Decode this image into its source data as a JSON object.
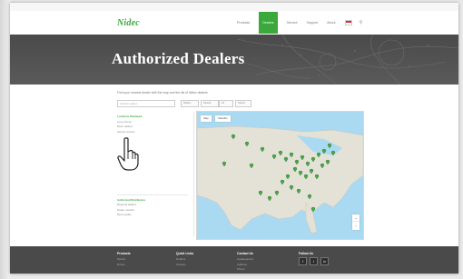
{
  "brand": {
    "logo_text": "Nidec",
    "accent": "#3aa83a"
  },
  "nav": {
    "items": [
      {
        "label": "Products",
        "active": false
      },
      {
        "label": "Dealers",
        "active": true
      },
      {
        "label": "Service",
        "active": false
      },
      {
        "label": "Support",
        "active": false
      },
      {
        "label": "About",
        "active": false
      }
    ]
  },
  "hero": {
    "title": "Authorized Dealers"
  },
  "intro": {
    "text": "Find your nearest dealer with the map and the list of Nidec dealers"
  },
  "search": {
    "placeholder": "Search location",
    "radius": "Radius",
    "results": "Results",
    "category": "All",
    "button": "Search"
  },
  "left_panel": {
    "section1_title": "Locations Displayed",
    "section1_lines": [
      "Leroy-Somer",
      "Motor dealers",
      "Service centers"
    ],
    "section2_title": "Authorized Distributors",
    "section2_lines": [
      "Regional dealers",
      "Dealer network",
      "More results"
    ]
  },
  "map": {
    "tab_map": "Map",
    "tab_satellite": "Satellite",
    "zoom_in": "+",
    "zoom_out": "−"
  },
  "footer": {
    "col1_title": "Products",
    "col1_links": [
      "Motors",
      "Drives"
    ],
    "col2_title": "Quick Links",
    "col2_links": [
      "Dealers",
      "Careers"
    ],
    "col3_title": "Contact Us",
    "col3_links": [
      "Headquarters",
      "Address",
      "Phone"
    ],
    "col4_title": "Follow Us",
    "social": [
      "f",
      "t",
      "in"
    ]
  }
}
